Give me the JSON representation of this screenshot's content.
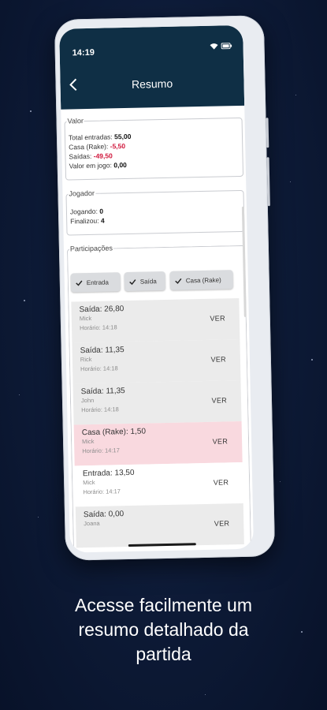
{
  "status_bar": {
    "time": "14:19"
  },
  "header": {
    "title": "Resumo"
  },
  "valor": {
    "legend": "Valor",
    "total_label": "Total entradas:",
    "total_value": "55,00",
    "casa_label": "Casa (Rake):",
    "casa_value": "-5,50",
    "saidas_label": "Saídas:",
    "saidas_value": "-49,50",
    "jogo_label": "Valor em jogo:",
    "jogo_value": "0,00"
  },
  "jogador": {
    "legend": "Jogador",
    "jogando_label": "Jogando:",
    "jogando_value": "0",
    "finalizou_label": "Finalizou:",
    "finalizou_value": "4"
  },
  "participacoes": {
    "legend": "Participações",
    "filters": [
      {
        "label": "Entrada",
        "checked": true
      },
      {
        "label": "Saída",
        "checked": true
      },
      {
        "label": "Casa (Rake)",
        "checked": true
      }
    ],
    "action_label": "VER",
    "items": [
      {
        "title": "Saída: 26,80",
        "player": "Mick",
        "time": "Horário: 14:18"
      },
      {
        "title": "Saída: 11,35",
        "player": "Rick",
        "time": "Horário: 14:18"
      },
      {
        "title": "Saída: 11,35",
        "player": "John",
        "time": "Horário: 14:18"
      },
      {
        "title": "Casa (Rake): 1,50",
        "player": "Mick",
        "time": "Horário: 14:17"
      },
      {
        "title": "Entrada: 13,50",
        "player": "Mick",
        "time": "Horário: 14:17"
      },
      {
        "title": "Saída: 0,00",
        "player": "Joana",
        "time": ""
      }
    ]
  },
  "caption": {
    "line1": "Acesse facilmente um",
    "line2": "resumo detalhado da",
    "line3": "partida"
  },
  "colors": {
    "appbar": "#0f2f45",
    "negative": "#d0163b",
    "rake_row": "#f9d9df"
  }
}
